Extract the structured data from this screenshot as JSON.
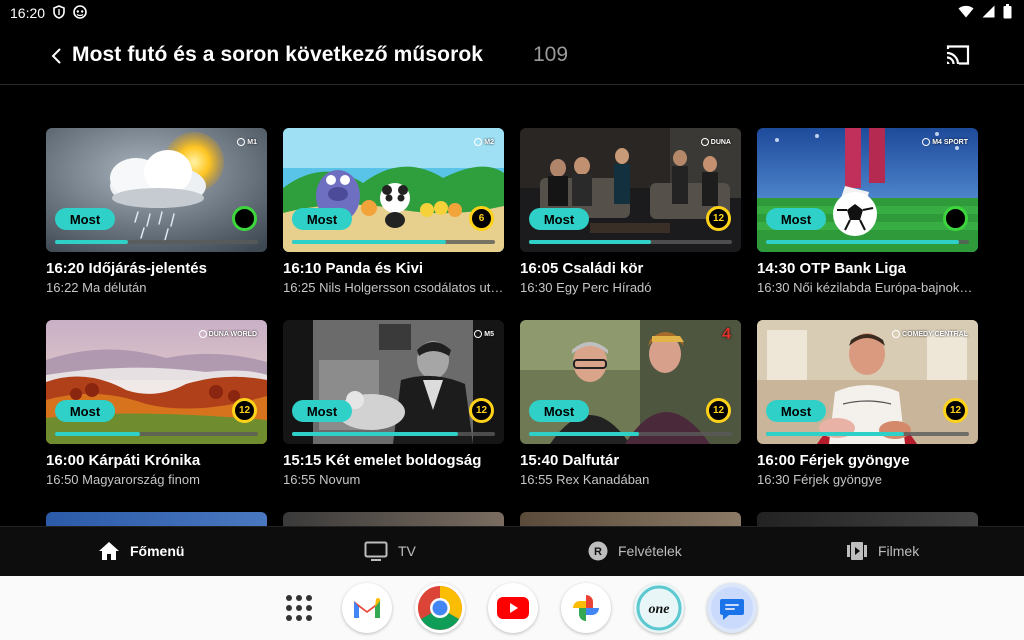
{
  "status": {
    "time": "16:20"
  },
  "header": {
    "title": "Most futó és a soron következő műsorok",
    "count": "109"
  },
  "now_label": "Most",
  "cards": [
    {
      "title": "16:20 Időjárás-jelentés",
      "next": "16:22 Ma délután",
      "channel": "M1",
      "rating": "",
      "progress": 0.36
    },
    {
      "title": "16:10 Panda és Kivi",
      "next": "16:25 Nils Holgersson csodálatos utazása",
      "channel": "M2",
      "rating": "6",
      "progress": 0.76
    },
    {
      "title": "16:05 Családi kör",
      "next": "16:30 Egy Perc Híradó",
      "channel": "DUNA",
      "rating": "12",
      "progress": 0.6
    },
    {
      "title": "14:30 OTP Bank Liga",
      "next": "16:30 Női kézilabda Európa-bajnokság",
      "channel": "M4 SPORT",
      "rating": "",
      "progress": 0.95
    },
    {
      "title": "16:00 Kárpáti Krónika",
      "next": "16:50 Magyarország finom",
      "channel": "DUNA WORLD",
      "rating": "12",
      "progress": 0.42
    },
    {
      "title": "15:15 Két emelet boldogság",
      "next": "16:55 Novum",
      "channel": "M5",
      "rating": "12",
      "progress": 0.82
    },
    {
      "title": "15:40 Dalfutár",
      "next": "16:55 Rex Kanadában",
      "channel": "4",
      "rating": "12",
      "progress": 0.54
    },
    {
      "title": "16:00 Férjek gyöngye",
      "next": "16:30 Férjek gyöngye",
      "channel": "COMEDY CENTRAL",
      "rating": "12",
      "progress": 0.68
    }
  ],
  "nav": [
    {
      "label": "Főmenü",
      "icon": "home-icon",
      "active": true
    },
    {
      "label": "TV",
      "icon": "tv-icon",
      "active": false
    },
    {
      "label": "Felvételek",
      "icon": "record-icon",
      "active": false
    },
    {
      "label": "Filmek",
      "icon": "film-icon",
      "active": false
    }
  ],
  "dock": [
    "app-drawer-icon",
    "gmail-icon",
    "chrome-icon",
    "youtube-icon",
    "photos-icon",
    "one-app-icon",
    "messages-icon"
  ],
  "colors": {
    "accent": "#2fd0c7",
    "rating_yellow": "#ffd21a",
    "rating_green": "#3cd63c",
    "background": "#000000"
  }
}
